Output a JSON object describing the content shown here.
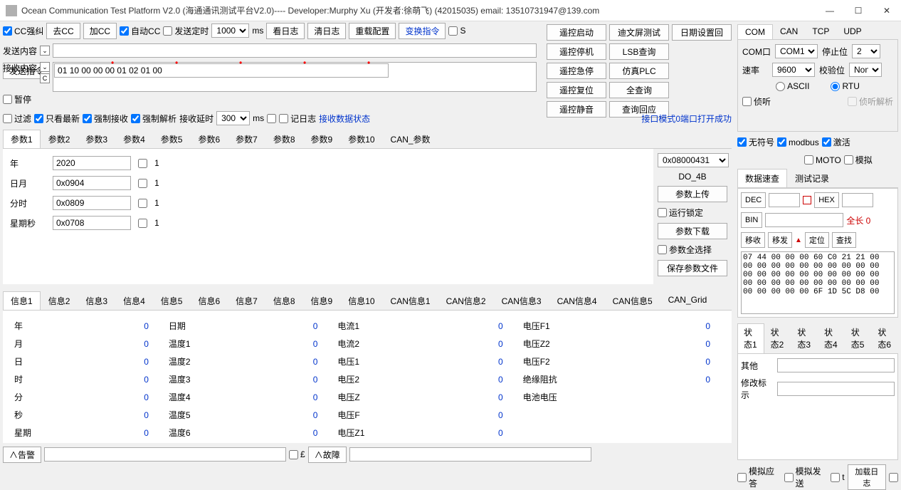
{
  "title": "Ocean Communication Test Platform V2.0 (海通通讯测试平台V2.0)---- Developer:Murphy Xu (开发者:徐萌飞)  (42015035)    email: 13510731947@139.com",
  "toolbar": {
    "send_cmd": "发送指令",
    "hex_input": "01 10 00 00 00 01 02 01 00",
    "remote_start_sel": "遥控启动",
    "num_sel": "1",
    "cc_correct": "CC强纠",
    "remove_cc": "去CC",
    "add_cc": "加CC",
    "auto_cc": "自动CC",
    "send_timer": "发送定时",
    "timer_val": "1000",
    "timer_unit": "ms",
    "view_log": "看日志",
    "clear_log": "清日志",
    "reload_cfg": "重载配置",
    "change_cmd": "变换指令",
    "s_check": "S"
  },
  "content": {
    "send_label": "发送内容",
    "recv_label": "接收内容",
    "pause": "暂停",
    "clear": "C"
  },
  "filters": {
    "filter": "过滤",
    "only_latest": "只看最新",
    "force_recv": "强制接收",
    "force_parse": "强制解析",
    "recv_delay": "接收延时",
    "delay_val": "300",
    "delay_unit": "ms",
    "log_chk": "记日志",
    "recv_status": "接收数据状态"
  },
  "param_tabs": [
    "参数1",
    "参数2",
    "参数3",
    "参数4",
    "参数5",
    "参数6",
    "参数7",
    "参数8",
    "参数9",
    "参数10",
    "CAN_参数"
  ],
  "params": [
    {
      "label": "年",
      "value": "2020",
      "chk": "1"
    },
    {
      "label": "日月",
      "value": "0x0904",
      "chk": "1"
    },
    {
      "label": "分时",
      "value": "0x0809",
      "chk": "1"
    },
    {
      "label": "星期秒",
      "value": "0x0708",
      "chk": "1"
    }
  ],
  "info_tabs": [
    "信息1",
    "信息2",
    "信息3",
    "信息4",
    "信息5",
    "信息6",
    "信息7",
    "信息8",
    "信息9",
    "信息10",
    "CAN信息1",
    "CAN信息2",
    "CAN信息3",
    "CAN信息4",
    "CAN信息5",
    "CAN_Grid"
  ],
  "info_rows": [
    [
      {
        "l": "年",
        "v": "0"
      },
      {
        "l": "日期",
        "v": "0"
      },
      {
        "l": "电流1",
        "v": "0"
      },
      {
        "l": "电压F1",
        "v": "0"
      }
    ],
    [
      {
        "l": "月",
        "v": "0"
      },
      {
        "l": "温度1",
        "v": "0"
      },
      {
        "l": "电流2",
        "v": "0"
      },
      {
        "l": "电压Z2",
        "v": "0"
      }
    ],
    [
      {
        "l": "日",
        "v": "0"
      },
      {
        "l": "温度2",
        "v": "0"
      },
      {
        "l": "电压1",
        "v": "0"
      },
      {
        "l": "电压F2",
        "v": "0"
      }
    ],
    [
      {
        "l": "时",
        "v": "0"
      },
      {
        "l": "温度3",
        "v": "0"
      },
      {
        "l": "电压2",
        "v": "0"
      },
      {
        "l": "绝缘阻抗",
        "v": "0"
      }
    ],
    [
      {
        "l": "分",
        "v": "0"
      },
      {
        "l": "温度4",
        "v": "0"
      },
      {
        "l": "电压Z",
        "v": "0"
      },
      {
        "l": "电池电压",
        "v": ""
      }
    ],
    [
      {
        "l": "秒",
        "v": "0"
      },
      {
        "l": "温度5",
        "v": "0"
      },
      {
        "l": "电压F",
        "v": "0"
      },
      {
        "l": "",
        "v": ""
      }
    ],
    [
      {
        "l": "星期",
        "v": "0"
      },
      {
        "l": "温度6",
        "v": "0"
      },
      {
        "l": "电压Z1",
        "v": "0"
      },
      {
        "l": "",
        "v": ""
      }
    ]
  ],
  "remote": {
    "col1": [
      "遥控启动",
      "遥控停机",
      "遥控急停",
      "遥控复位",
      "遥控静音"
    ],
    "col2": [
      "迪文屏测试",
      "LSB查询",
      "仿真PLC",
      "全查询",
      "查询回应"
    ],
    "col3": [
      "日期设置回"
    ]
  },
  "side_panel": {
    "addr_sel": "0x08000431",
    "do_label": "DO_4B",
    "param_upload": "参数上传",
    "run_lock": "运行锁定",
    "param_download": "参数下载",
    "param_all": "参数全选择",
    "save_param": "保存参数文件",
    "port_status": "接口模式0端口打开成功",
    "unsigned": "无符号",
    "modbus": "modbus",
    "activate": "激活",
    "moto": "MOTO",
    "sim": "模拟"
  },
  "comm_tabs": [
    "COM",
    "CAN",
    "TCP",
    "UDP"
  ],
  "comm": {
    "com_label": "COM口",
    "com_val": "COM1",
    "stop_label": "停止位",
    "stop_val": "2",
    "rate_label": "速率",
    "rate_val": "9600",
    "parity_label": "校验位",
    "parity_val": "None",
    "ascii": "ASCII",
    "rtu": "RTU",
    "listen": "侦听",
    "listen_parse": "侦听解析"
  },
  "data_tabs": [
    "数据速查",
    "测试记录"
  ],
  "data_panel": {
    "dec": "DEC",
    "hex": "HEX",
    "bin": "BIN",
    "total_len": "全长 0",
    "move_recv": "移收",
    "move_send": "移发",
    "locate": "定位",
    "find": "查找",
    "hex_dump": "07 44 00 00 00 60 C0 21 21 00\n00 00 00 00 00 00 00 00 00 00\n00 00 00 00 00 00 00 00 00 00\n00 00 00 00 00 00 00 00 00 00\n00 00 00 00 00 6F 1D 5C D8 00"
  },
  "status_tabs": [
    "状态1",
    "状态2",
    "状态3",
    "状态4",
    "状态5",
    "状态6"
  ],
  "status_panel": {
    "other": "其他",
    "modify_flag": "修改标示"
  },
  "bottom": {
    "alarm": "∧告警",
    "fault_chk": "£",
    "fault": "∧故障",
    "sim_resp": "模拟应答",
    "sim_send": "模拟发送",
    "t_chk": "t",
    "load_log": "加载日志"
  }
}
